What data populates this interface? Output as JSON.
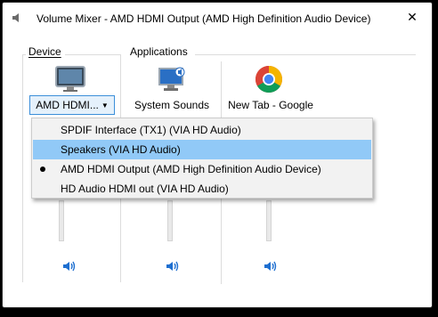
{
  "window": {
    "title": "Volume Mixer - AMD HDMI Output (AMD High Definition Audio Device)",
    "close_symbol": "✕"
  },
  "device_group": {
    "label": "Device"
  },
  "applications_group": {
    "label": "Applications"
  },
  "device": {
    "button_label": "AMD HDMI...",
    "arrow": "▼",
    "icon": "monitor-icon"
  },
  "applications": [
    {
      "label": "System Sounds",
      "icon": "system-sounds-icon"
    },
    {
      "label": "New Tab - Google",
      "icon": "chrome-icon"
    }
  ],
  "dropdown": {
    "items": [
      {
        "label": "SPDIF Interface (TX1) (VIA HD Audio)",
        "highlighted": false,
        "selected": false
      },
      {
        "label": "Speakers (VIA HD Audio)",
        "highlighted": true,
        "selected": false
      },
      {
        "label": "AMD HDMI Output (AMD High Definition Audio Device)",
        "highlighted": false,
        "selected": true
      },
      {
        "label": "HD Audio HDMI out (VIA HD Audio)",
        "highlighted": false,
        "selected": false
      }
    ]
  },
  "colors": {
    "highlight": "#91c9f7",
    "accent": "#3c8fd9",
    "speaker_blue": "#1e6fd0"
  }
}
